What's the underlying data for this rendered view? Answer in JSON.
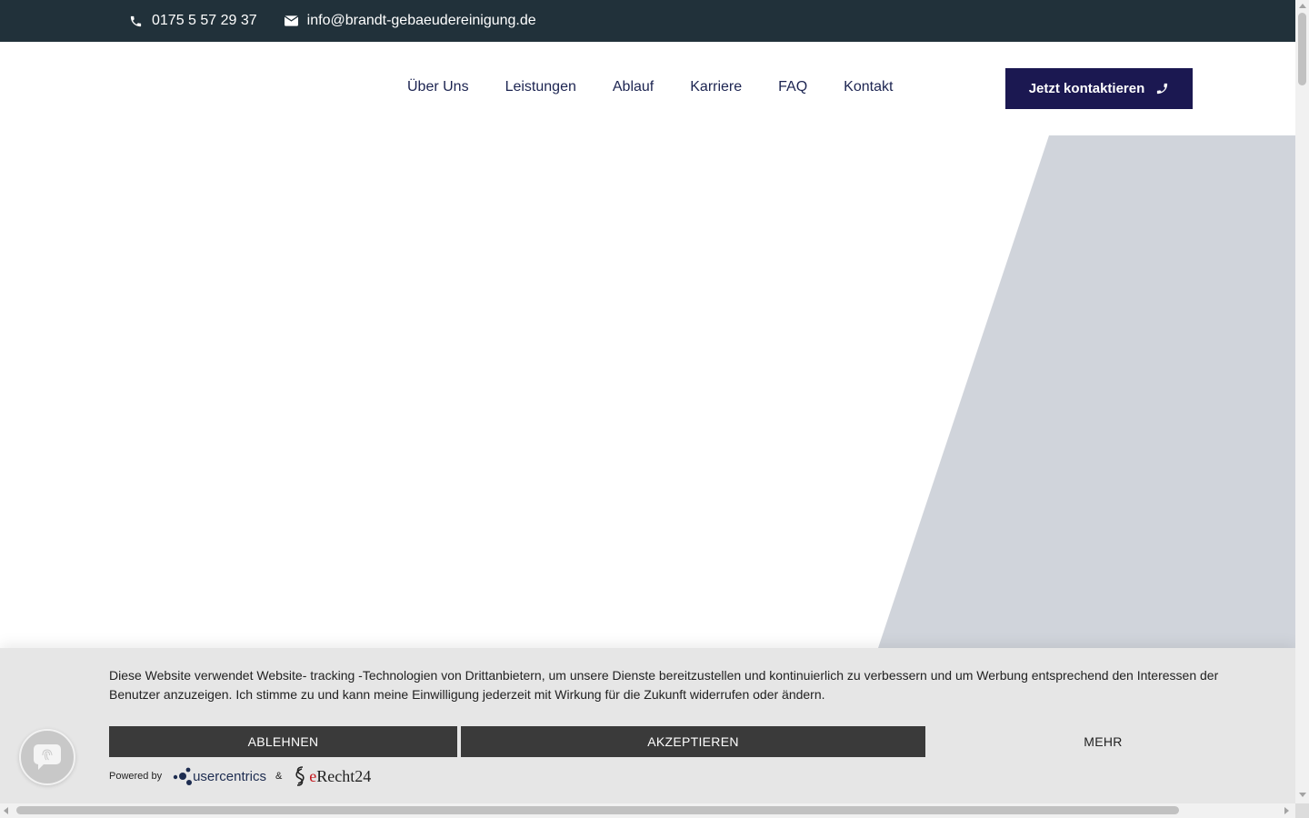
{
  "topbar": {
    "phone": "0175 5 57 29 37",
    "email": "info@brandt-gebaeudereinigung.de",
    "phone_icon": "phone-icon",
    "email_icon": "envelope-icon"
  },
  "nav": {
    "items": [
      {
        "label": "Über Uns"
      },
      {
        "label": "Leistungen"
      },
      {
        "label": "Ablauf"
      },
      {
        "label": "Karriere"
      },
      {
        "label": "FAQ"
      },
      {
        "label": "Kontakt"
      }
    ],
    "cta_label": "Jetzt kontaktieren",
    "cta_icon": "phone-icon"
  },
  "cookie": {
    "text": "Diese Website verwendet Website- tracking -Technologien von Drittanbietern, um unsere Dienste bereitzustellen und kontinuierlich zu verbessern und um Werbung entsprechend den Interessen der Benutzer anzuzeigen. Ich stimme zu und kann meine Einwilligung jederzeit mit Wirkung für die Zukunft widerrufen oder ändern.",
    "decline_label": "ABLEHNEN",
    "accept_label": "AKZEPTIEREN",
    "more_label": "MEHR",
    "powered_by": "Powered by",
    "usercentrics": "usercentrics",
    "ampersand": "&",
    "erecht_e": "e",
    "erecht_rest": "Recht24"
  },
  "colors": {
    "topbar_bg": "#21313a",
    "nav_text": "#1c2451",
    "cta_bg": "#1b1851",
    "hero_shape": "#d0d4db",
    "cookie_bg": "#e6e6e6",
    "cookie_button": "#3a3a3a"
  }
}
